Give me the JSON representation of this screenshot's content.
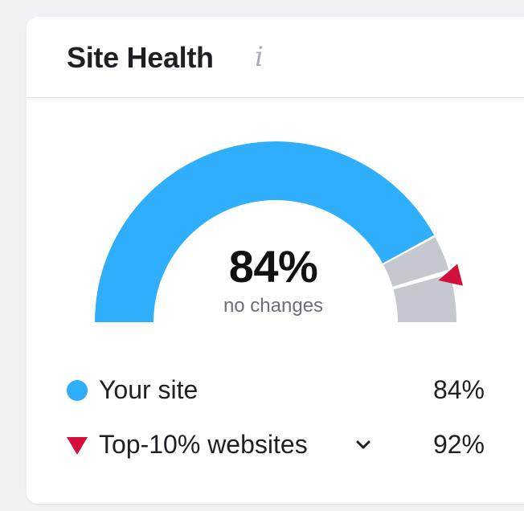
{
  "widget": {
    "title": "Site Health",
    "info_icon": "info-icon",
    "info_glyph": "i"
  },
  "gauge": {
    "value_label": "84%",
    "subtitle": "no changes",
    "your_site_percent": 84,
    "top10_percent": 92,
    "colors": {
      "your_site": "#2eaefb",
      "remainder": "#c6c8d0",
      "top10_marker": "#d30f3b"
    }
  },
  "legend": [
    {
      "label": "Your site",
      "value": "84%",
      "marker": "circle",
      "color": "#2eaefb"
    },
    {
      "label": "Top-10% websites",
      "value": "92%",
      "marker": "triangle-down",
      "color": "#d30f3b",
      "icon": "chevron-down-icon"
    }
  ]
}
